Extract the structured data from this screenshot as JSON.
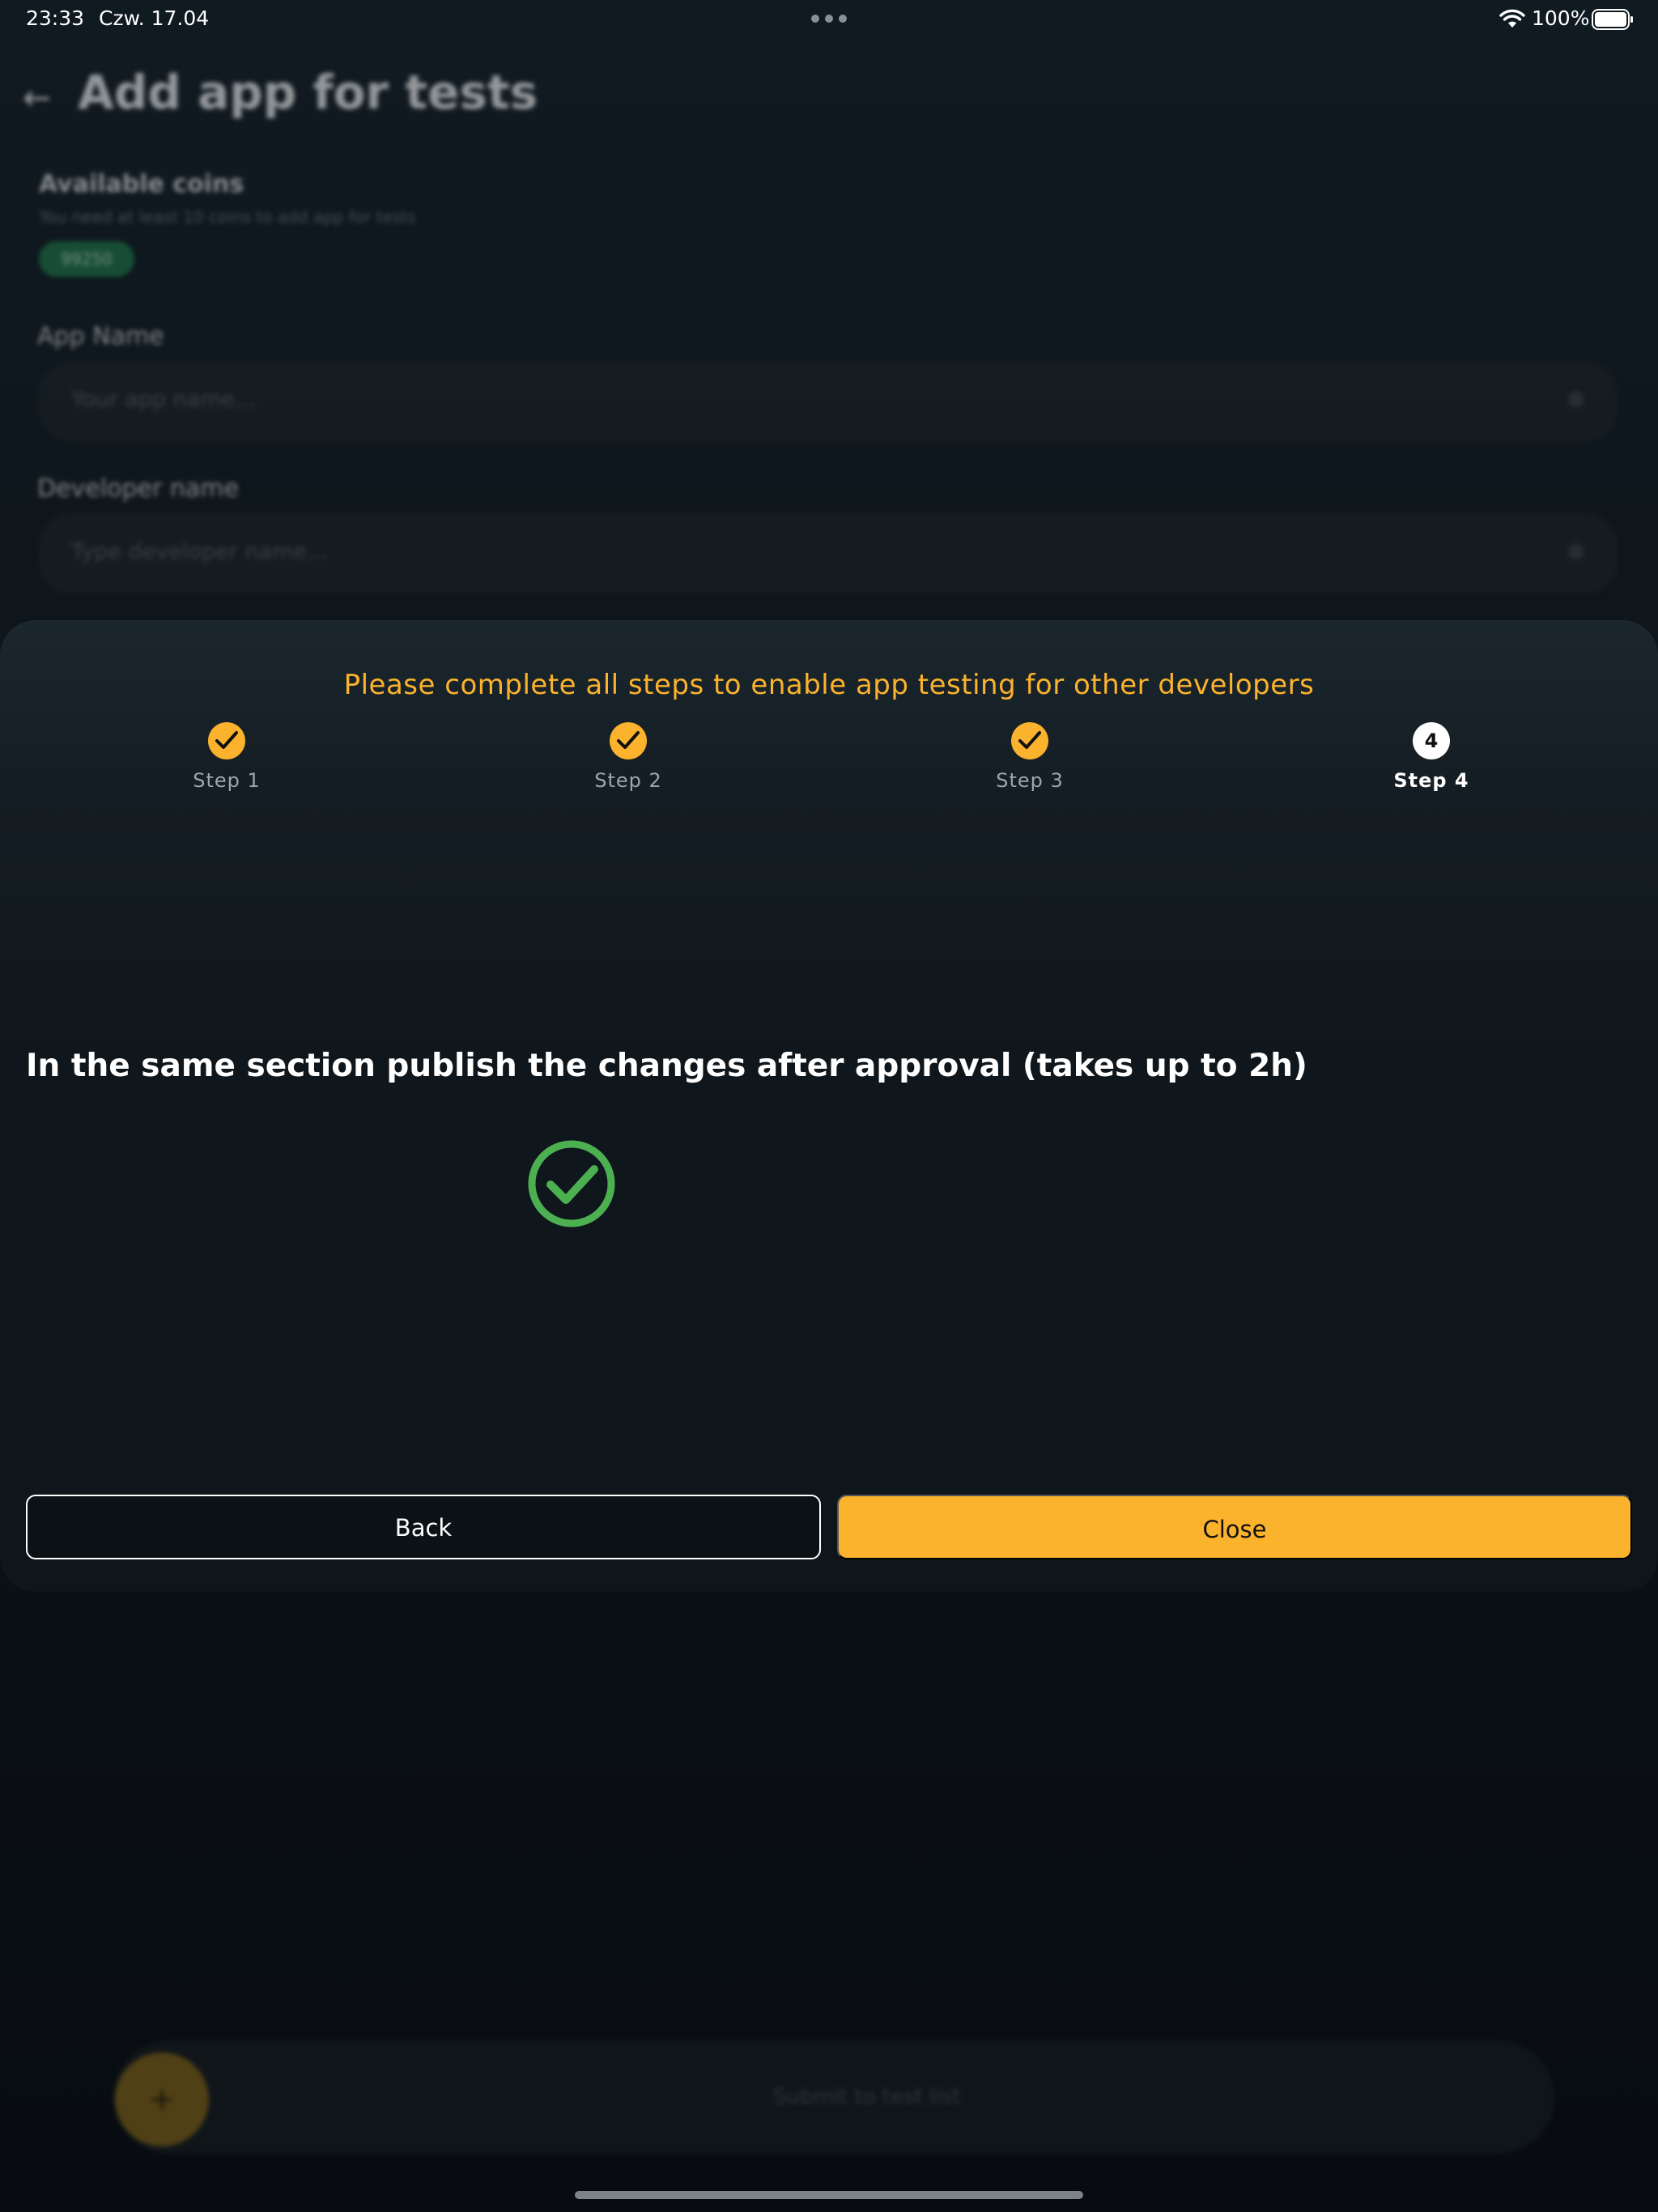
{
  "status_bar": {
    "time": "23:33",
    "date": "Czw. 17.04",
    "battery": "100%"
  },
  "background_page": {
    "back_icon": "←",
    "title": "Add app for tests",
    "coins_title": "Available coins",
    "coins_subtitle": "You need at least 10 coins to add app for tests",
    "coins_value": "99250",
    "app_name_label": "App Name",
    "app_name_placeholder": "Your app name...",
    "developer_name_label": "Developer name",
    "developer_name_placeholder": "Type developer name...",
    "clear_icon": "⊗",
    "fab_icon": "+",
    "bottom_bar_label": "Submit to test list"
  },
  "sheet": {
    "heading": "Please complete all steps to enable app testing for other developers",
    "steps": [
      {
        "label": "Step 1",
        "state": "done"
      },
      {
        "label": "Step 2",
        "state": "done"
      },
      {
        "label": "Step 3",
        "state": "done"
      },
      {
        "label": "Step 4",
        "number": "4",
        "state": "current"
      }
    ],
    "instruction": "In the same section publish the changes after approval (takes up to 2h)",
    "back_label": "Back",
    "close_label": "Close"
  },
  "colors": {
    "accent": "#fbb22c",
    "success": "#4caf50",
    "sheet_bg": "#10171c"
  },
  "icons": {
    "step_done": "check-icon",
    "success": "check-circle-icon",
    "wifi": "wifi-icon",
    "battery": "battery-icon"
  }
}
